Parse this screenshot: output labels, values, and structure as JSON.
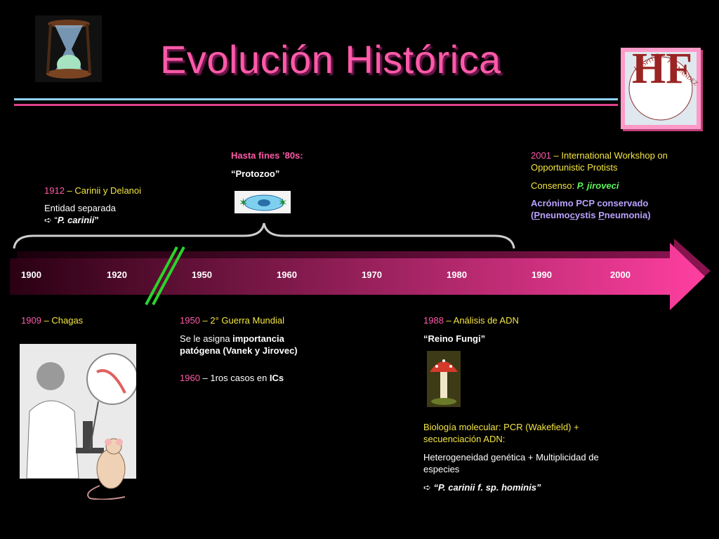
{
  "title": "Evolución Histórica",
  "timeline": {
    "years": [
      "1900",
      "1920",
      "1950",
      "1960",
      "1970",
      "1980",
      "1990",
      "2000"
    ]
  },
  "top_left": {
    "year": "1912",
    "text": " – Carinii y Delanoi",
    "line2": "Entidad separada",
    "arrow": "➪ “",
    "italic": "P. carinii",
    "close": "”"
  },
  "top_mid": {
    "heading": "Hasta fines ’80s:",
    "text": "“Protozoo”"
  },
  "top_right": {
    "year": "2001",
    "text": " – International Workshop on Opportunistic Protists",
    "consenso_label": "Consenso: ",
    "consenso_value": "P. jiroveci",
    "acronimo_line1": "Acrónimo PCP conservado",
    "acr_open": "(",
    "acr_p1": "P",
    "acr_mid1": "neumo",
    "acr_c": "c",
    "acr_mid2": "ystis ",
    "acr_p2": "P",
    "acr_end": "neumonia)"
  },
  "bottom_left": {
    "year": "1909",
    "text": " – Chagas"
  },
  "bottom_mid": {
    "year1": "1950",
    "text1": " – 2° Guerra Mundial",
    "line2a": "Se le asigna ",
    "line2b": "importancia patógena (Vanek y Jirovec)",
    "year2": "1960",
    "text2a": " – 1ros casos en ",
    "text2b": "ICs"
  },
  "bottom_right": {
    "year": "1988",
    "text": " – Análisis de ADN",
    "reino": "“Reino Fungi”",
    "bio": "Biología molecular: PCR (Wakefield) + secuenciación ADN:",
    "hetero": "Heterogeneidad genética + Multiplicidad de especies",
    "arrow": "➪ ",
    "italic": "“P. carinii f. sp. hominis”"
  },
  "logo": {
    "text_top": "HOSPITAL",
    "text_right": "FERNANDEZ",
    "letters": "HF"
  },
  "colors": {
    "title": "#ff5aa8",
    "year": "#ff5aa8",
    "highlight": "#f5e642",
    "species": "#5cf25c",
    "acronym": "#b9a2ff",
    "arrow_start": "#2a0012",
    "arrow_end": "#ff3fa0"
  }
}
